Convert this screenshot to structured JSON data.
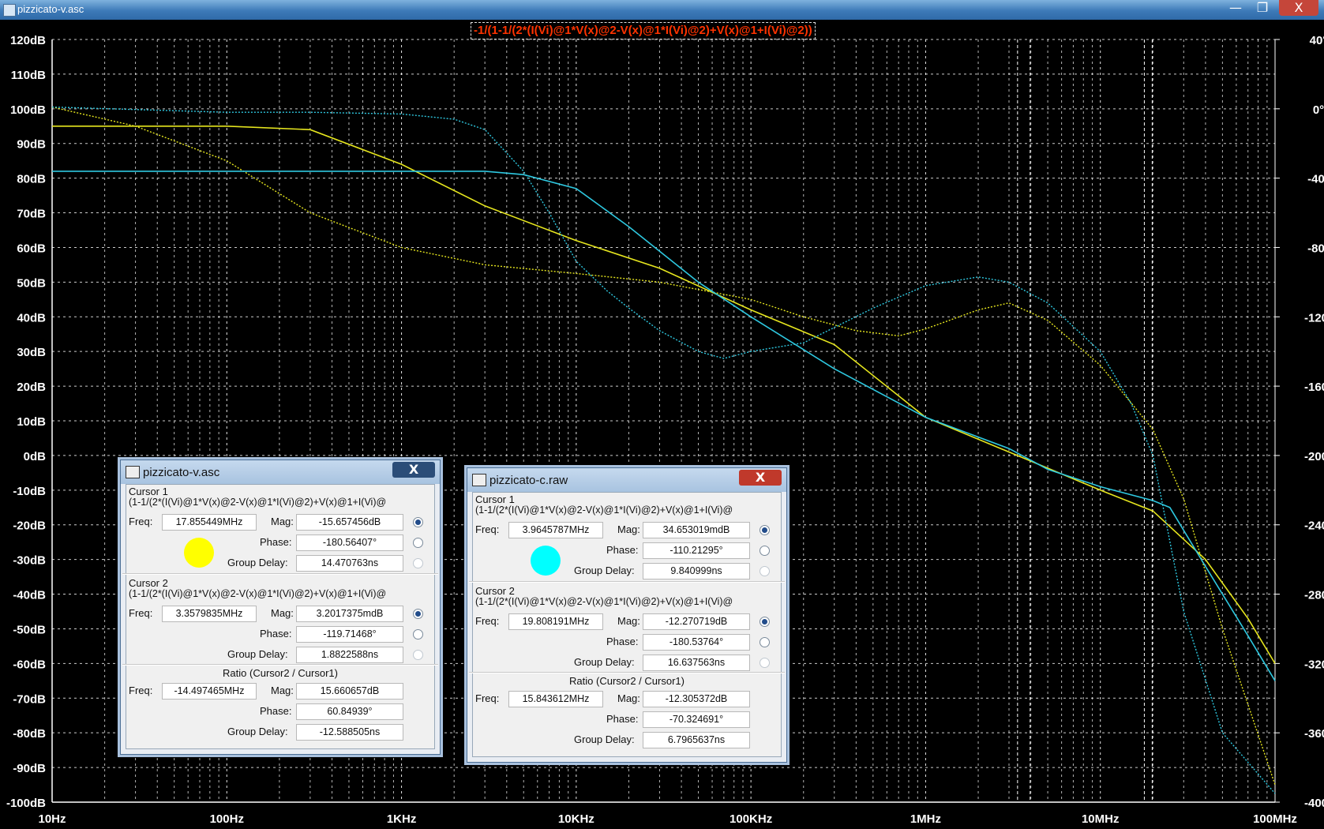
{
  "window": {
    "title": "pizzicato-v.asc",
    "min": "—",
    "restore": "❐",
    "close": "X"
  },
  "plot_title": "-1/(1-1/(2*(I(Vi)@1*V(x)@2-V(x)@1*I(Vi)@2)+V(x)@1+I(Vi)@2))",
  "chart_data": {
    "type": "line",
    "xscale": "log",
    "xlim": [
      10,
      100000000
    ],
    "x_ticks": [
      "10Hz",
      "100Hz",
      "1KHz",
      "10KHz",
      "100KHz",
      "1MHz",
      "10MHz",
      "100MHz"
    ],
    "y_left": {
      "unit": "dB",
      "ylim": [
        -100,
        120
      ],
      "ticks": [
        "120dB",
        "110dB",
        "100dB",
        "90dB",
        "80dB",
        "70dB",
        "60dB",
        "50dB",
        "40dB",
        "30dB",
        "20dB",
        "10dB",
        "0dB",
        "-10dB",
        "-20dB",
        "-30dB",
        "-40dB",
        "-50dB",
        "-60dB",
        "-70dB",
        "-80dB",
        "-90dB",
        "-100dB"
      ]
    },
    "y_right": {
      "unit": "degree",
      "ylim": [
        -400,
        40
      ],
      "ticks": [
        "40°",
        "0°",
        "-40°",
        "-80°",
        "-120°",
        "-160°",
        "-200°",
        "-240°",
        "-280°",
        "-320°",
        "-360°",
        "-400°"
      ]
    },
    "grid": true,
    "colors": {
      "yellow": "#e6e61e",
      "cyan": "#2ec8e0",
      "grid": "#ffffff"
    },
    "series": [
      {
        "color": "yellow",
        "kind": "magnitude",
        "x": [
          10,
          100,
          300,
          1000,
          3000,
          10000,
          30000,
          100000,
          300000,
          1000000,
          3000000,
          10000000,
          20000000,
          40000000,
          70000000,
          100000000
        ],
        "values": [
          95,
          95,
          94,
          84,
          72,
          62,
          54,
          42,
          32,
          11,
          1,
          -10,
          -16,
          -30,
          -47,
          -60
        ]
      },
      {
        "color": "yellow",
        "kind": "phase",
        "x": [
          10,
          30,
          100,
          300,
          1000,
          3000,
          10000,
          30000,
          100000,
          200000,
          400000,
          700000,
          1000000,
          2000000,
          3000000,
          5000000,
          10000000,
          20000000,
          30000000,
          50000000,
          100000000
        ],
        "values": [
          1,
          -10,
          -30,
          -60,
          -80,
          -90,
          -95,
          -100,
          -110,
          -120,
          -128,
          -131,
          -127,
          -116,
          -112,
          -122,
          -148,
          -185,
          -225,
          -300,
          -390
        ]
      },
      {
        "color": "cyan",
        "kind": "magnitude",
        "x": [
          10,
          100,
          1000,
          3000,
          5000,
          10000,
          20000,
          50000,
          100000,
          300000,
          1000000,
          3000000,
          5000000,
          10000000,
          20000000,
          25000000,
          40000000,
          70000000,
          100000000
        ],
        "values": [
          82,
          82,
          82,
          82,
          81,
          77,
          66,
          50,
          40,
          25,
          11,
          2,
          -4,
          -9,
          -13,
          -15,
          -32,
          -52,
          -65
        ]
      },
      {
        "color": "cyan",
        "kind": "phase",
        "x": [
          10,
          100,
          300,
          1000,
          2000,
          3000,
          5000,
          7000,
          10000,
          15000,
          20000,
          30000,
          50000,
          70000,
          100000,
          200000,
          500000,
          1000000,
          2000000,
          3000000,
          5000000,
          10000000,
          15000000,
          20000000,
          30000000,
          50000000,
          100000000
        ],
        "values": [
          1,
          -2,
          -2,
          -3,
          -6,
          -12,
          -36,
          -60,
          -88,
          -105,
          -115,
          -128,
          -140,
          -144,
          -140,
          -135,
          -115,
          -102,
          -97,
          -100,
          -112,
          -140,
          -170,
          -200,
          -290,
          -360,
          -395
        ]
      }
    ]
  },
  "dialogs": [
    {
      "title": "pizzicato-v.asc",
      "close": "X",
      "dot_color": "#ffff00",
      "cursor1": {
        "heading": "Cursor 1",
        "expr": "(1-1/(2*(I(Vi)@1*V(x)@2-V(x)@1*I(Vi)@2)+V(x)@1+I(Vi)@",
        "freq": "17.855449MHz",
        "mag": "-15.657456dB",
        "phase": "-180.56407°",
        "group_delay": "14.470763ns"
      },
      "cursor2": {
        "heading": "Cursor 2",
        "expr": "(1-1/(2*(I(Vi)@1*V(x)@2-V(x)@1*I(Vi)@2)+V(x)@1+I(Vi)@",
        "freq": "3.3579835MHz",
        "mag": "3.2017375mdB",
        "phase": "-119.71468°",
        "group_delay": "1.8822588ns"
      },
      "ratio": {
        "heading": "Ratio (Cursor2 / Cursor1)",
        "freq": "-14.497465MHz",
        "mag": "15.660657dB",
        "phase": "60.84939°",
        "group_delay": "-12.588505ns"
      }
    },
    {
      "title": "pizzicato-c.raw",
      "close": "X",
      "dot_color": "#00ffff",
      "cursor1": {
        "heading": "Cursor 1",
        "expr": "(1-1/(2*(I(Vi)@1*V(x)@2-V(x)@1*I(Vi)@2)+V(x)@1+I(Vi)@",
        "freq": "3.9645787MHz",
        "mag": "34.653019mdB",
        "phase": "-110.21295°",
        "group_delay": "9.840999ns"
      },
      "cursor2": {
        "heading": "Cursor 2",
        "expr": "(1-1/(2*(I(Vi)@1*V(x)@2-V(x)@1*I(Vi)@2)+V(x)@1+I(Vi)@",
        "freq": "19.808191MHz",
        "mag": "-12.270719dB",
        "phase": "-180.53764°",
        "group_delay": "16.637563ns"
      },
      "ratio": {
        "heading": "Ratio (Cursor2 / Cursor1)",
        "freq": "15.843612MHz",
        "mag": "-12.305372dB",
        "phase": "-70.324691°",
        "group_delay": "6.7965637ns"
      }
    }
  ],
  "labels": {
    "freq": "Freq:",
    "mag": "Mag:",
    "phase": "Phase:",
    "group_delay": "Group Delay:"
  }
}
